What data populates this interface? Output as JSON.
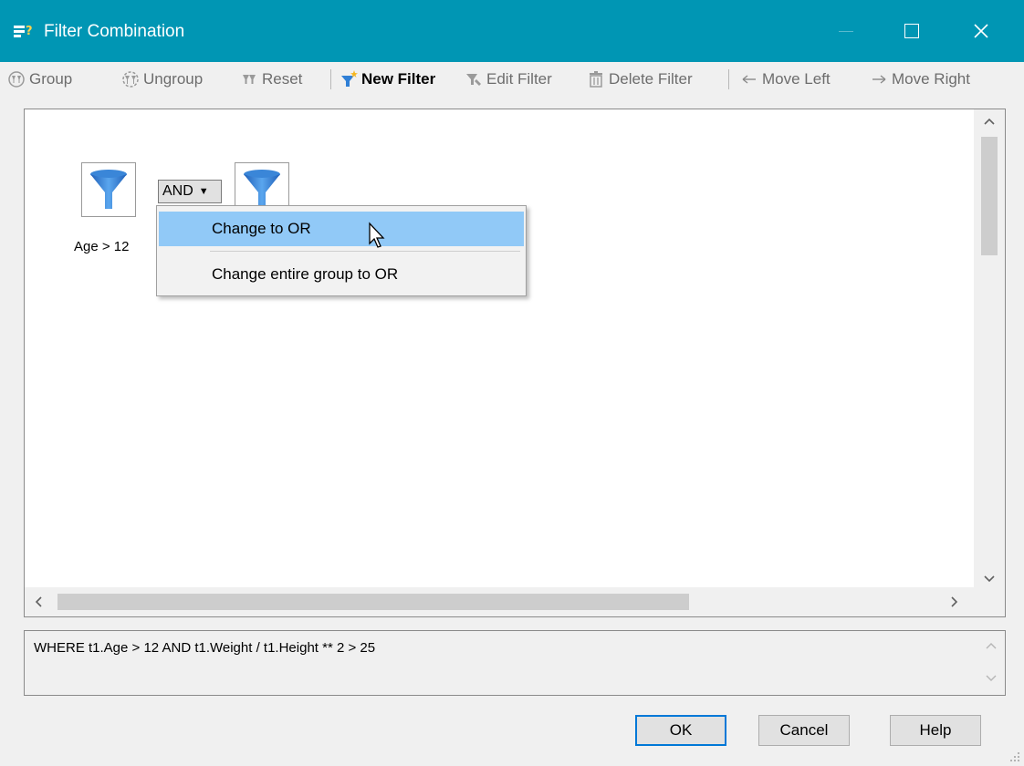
{
  "window": {
    "title": "Filter Combination",
    "icon": "filter-combination-icon"
  },
  "toolbar": {
    "group": "Group",
    "ungroup": "Ungroup",
    "reset": "Reset",
    "new_filter": "New Filter",
    "edit_filter": "Edit Filter",
    "delete_filter": "Delete Filter",
    "move_left": "Move Left",
    "move_right": "Move Right"
  },
  "canvas": {
    "filter1_label": "Age > 12",
    "operator": "AND",
    "operator_caret": "▼"
  },
  "context_menu": {
    "item1": "Change to OR",
    "item2": "Change entire group to OR"
  },
  "where_clause": "WHERE t1.Age > 12 AND t1.Weight / t1.Height ** 2 > 25",
  "buttons": {
    "ok": "OK",
    "cancel": "Cancel",
    "help": "Help"
  },
  "colors": {
    "titlebar": "#0096b4",
    "menu_highlight": "#91c9f7",
    "default_button_border": "#0078d7"
  }
}
